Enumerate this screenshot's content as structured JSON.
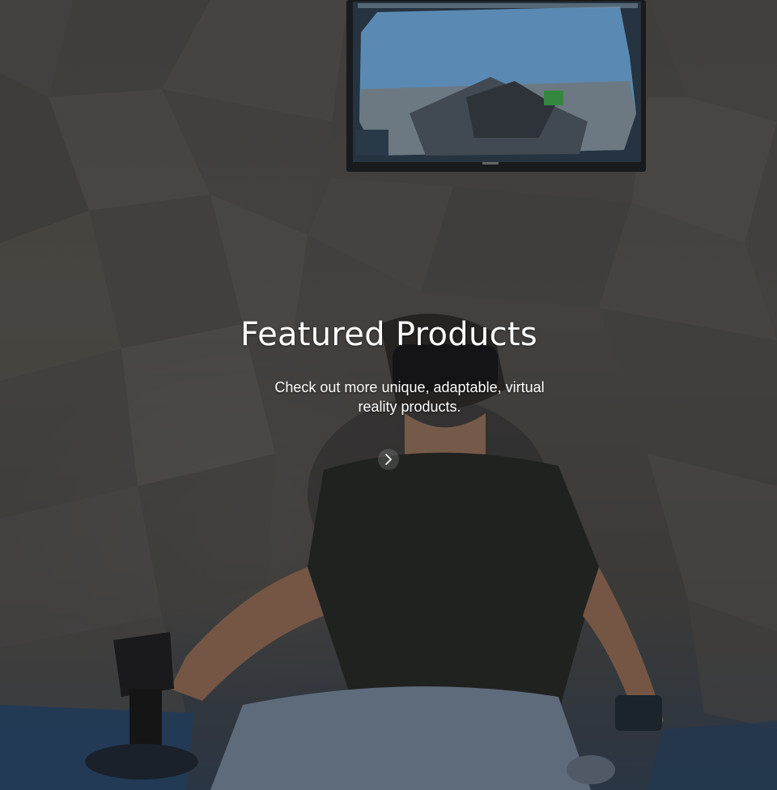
{
  "hero": {
    "title": "Featured Products",
    "subtitle": "Check out more unique, adaptable, virtual reality products.",
    "next_icon": "chevron-right-icon",
    "background_photo": "man-in-vr-headset-flight-simulator-photo"
  },
  "colors": {
    "text": "#ffffff",
    "overlay": "#1e1e20"
  }
}
